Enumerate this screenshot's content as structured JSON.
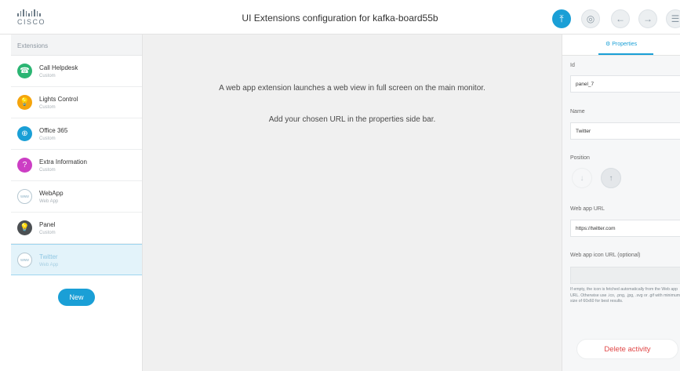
{
  "header": {
    "logo_text": "CISCO",
    "title": "UI Extensions configuration for kafka-board55b",
    "buttons": {
      "upload_icon": "⤒",
      "preview_icon": "◎",
      "undo_icon": "←",
      "redo_icon": "→",
      "menu_icon": "☰"
    }
  },
  "sidebar": {
    "heading": "Extensions",
    "items": [
      {
        "name": "Call Helpdesk",
        "sub": "Custom",
        "color": "#2bb573",
        "glyph": "☎"
      },
      {
        "name": "Lights Control",
        "sub": "Custom",
        "color": "#f5a40c",
        "glyph": "💡"
      },
      {
        "name": "Office 365",
        "sub": "Custom",
        "color": "#1a9fd6",
        "glyph": "⊕"
      },
      {
        "name": "Extra Information",
        "sub": "Custom",
        "color": "#cc3ec4",
        "glyph": "?"
      },
      {
        "name": "WebApp",
        "sub": "Web App",
        "color": "outline",
        "glyph": "www"
      },
      {
        "name": "Panel",
        "sub": "Custom",
        "color": "#4b4f52",
        "glyph": "💡"
      },
      {
        "name": "Twitter",
        "sub": "Web App",
        "color": "outline",
        "glyph": "www"
      }
    ],
    "new_label": "New"
  },
  "main": {
    "line1": "A web app extension launches a web view in full screen on the main monitor.",
    "line2": "Add your chosen URL in the properties side bar."
  },
  "properties": {
    "tab_label": "⚙ Properties",
    "id_label": "Id",
    "id_value": "panel_7",
    "name_label": "Name",
    "name_value": "Twitter",
    "position_label": "Position",
    "down_icon": "↓",
    "up_icon": "↑",
    "url_label": "Web app URL",
    "url_value": "https://twitter.com",
    "icon_url_label": "Web app icon URL (optional)",
    "icon_url_value": "",
    "hint": "If empty, the icon is fetched automatically from the Web app URL. Otherwise use .ico, .png, .jpg, .svg or .gif with minimum size of 60x60 for best results.",
    "delete_label": "Delete activity"
  },
  "colors": {
    "accent": "#1a9fd6",
    "danger": "#e04646",
    "canvas": "#f0f0f0"
  }
}
